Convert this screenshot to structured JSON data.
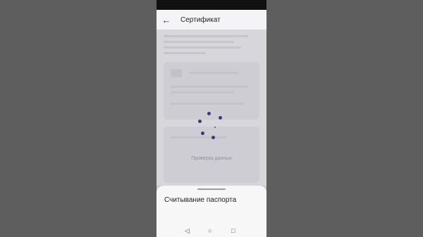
{
  "app_bar": {
    "title": "Сертификат",
    "back_icon": "arrow-left-icon"
  },
  "main": {
    "check_status": "Проверка данных"
  },
  "bottom_sheet": {
    "title": "Считывание паспорта"
  },
  "nav": {
    "back_glyph": "◁",
    "home_glyph": "○",
    "recent_glyph": "□"
  },
  "colors": {
    "spinner": "#3b3a7a",
    "sheet": "#f7f7f8"
  }
}
